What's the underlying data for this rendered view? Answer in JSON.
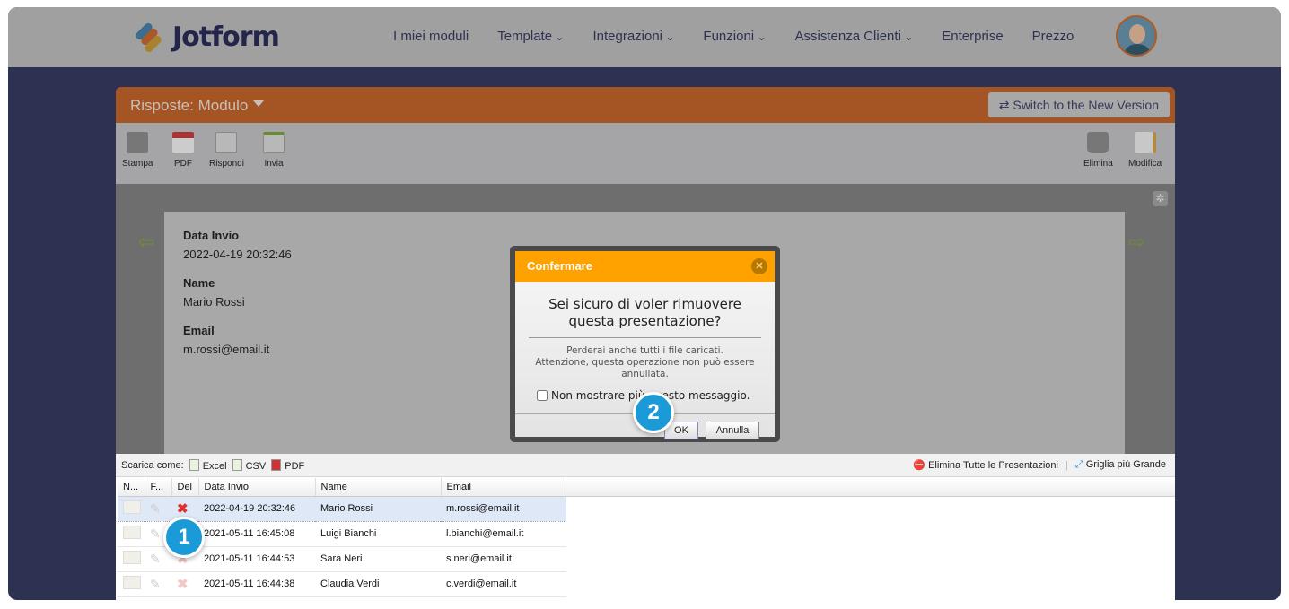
{
  "brand": {
    "name": "Jotform",
    "colors": [
      "#3a8bc9",
      "#e0682a",
      "#f0a830"
    ]
  },
  "nav": {
    "items": [
      "I miei moduli",
      "Template",
      "Integrazioni",
      "Funzioni",
      "Assistenza Clienti",
      "Enterprise",
      "Prezzo"
    ]
  },
  "app": {
    "title": "Risposte: Modulo",
    "switch_label": "Switch to the New Version",
    "toolbar_left": [
      "Stampa",
      "PDF",
      "Rispondi",
      "Invia"
    ],
    "toolbar_right": [
      "Elimina",
      "Modifica"
    ]
  },
  "submission": {
    "fields": [
      {
        "label": "Data Invio",
        "value": "2022-04-19 20:32:46"
      },
      {
        "label": "Name",
        "value": "Mario Rossi"
      },
      {
        "label": "Email",
        "value": "m.rossi@email.it"
      }
    ]
  },
  "dialog": {
    "title": "Confermare",
    "question1": "Sei sicuro di voler rimuovere",
    "question2": "questa presentazione?",
    "msg1": "Perderai anche tutti i file caricati.",
    "msg2": "Attenzione, questa operazione non può essere",
    "msg3": "annullata.",
    "checkbox": "Non mostrare più questo messaggio.",
    "ok": "OK",
    "cancel": "Annulla"
  },
  "badges": [
    "1",
    "2"
  ],
  "grid": {
    "download_label": "Scarica come:",
    "formats": [
      "Excel",
      "CSV",
      "PDF"
    ],
    "delete_all": "Elimina Tutte le Presentazioni",
    "bigger_grid": "Griglia più Grande",
    "columns": [
      "N...",
      "F...",
      "Del",
      "Data Invio",
      "Name",
      "Email"
    ],
    "rows": [
      {
        "date": "2022-04-19 20:32:46",
        "name": "Mario Rossi",
        "email": "m.rossi@email.it"
      },
      {
        "date": "2021-05-11 16:45:08",
        "name": "Luigi Bianchi",
        "email": "l.bianchi@email.it"
      },
      {
        "date": "2021-05-11 16:44:53",
        "name": "Sara Neri",
        "email": "s.neri@email.it"
      },
      {
        "date": "2021-05-11 16:44:38",
        "name": "Claudia Verdi",
        "email": "c.verdi@email.it"
      }
    ]
  }
}
